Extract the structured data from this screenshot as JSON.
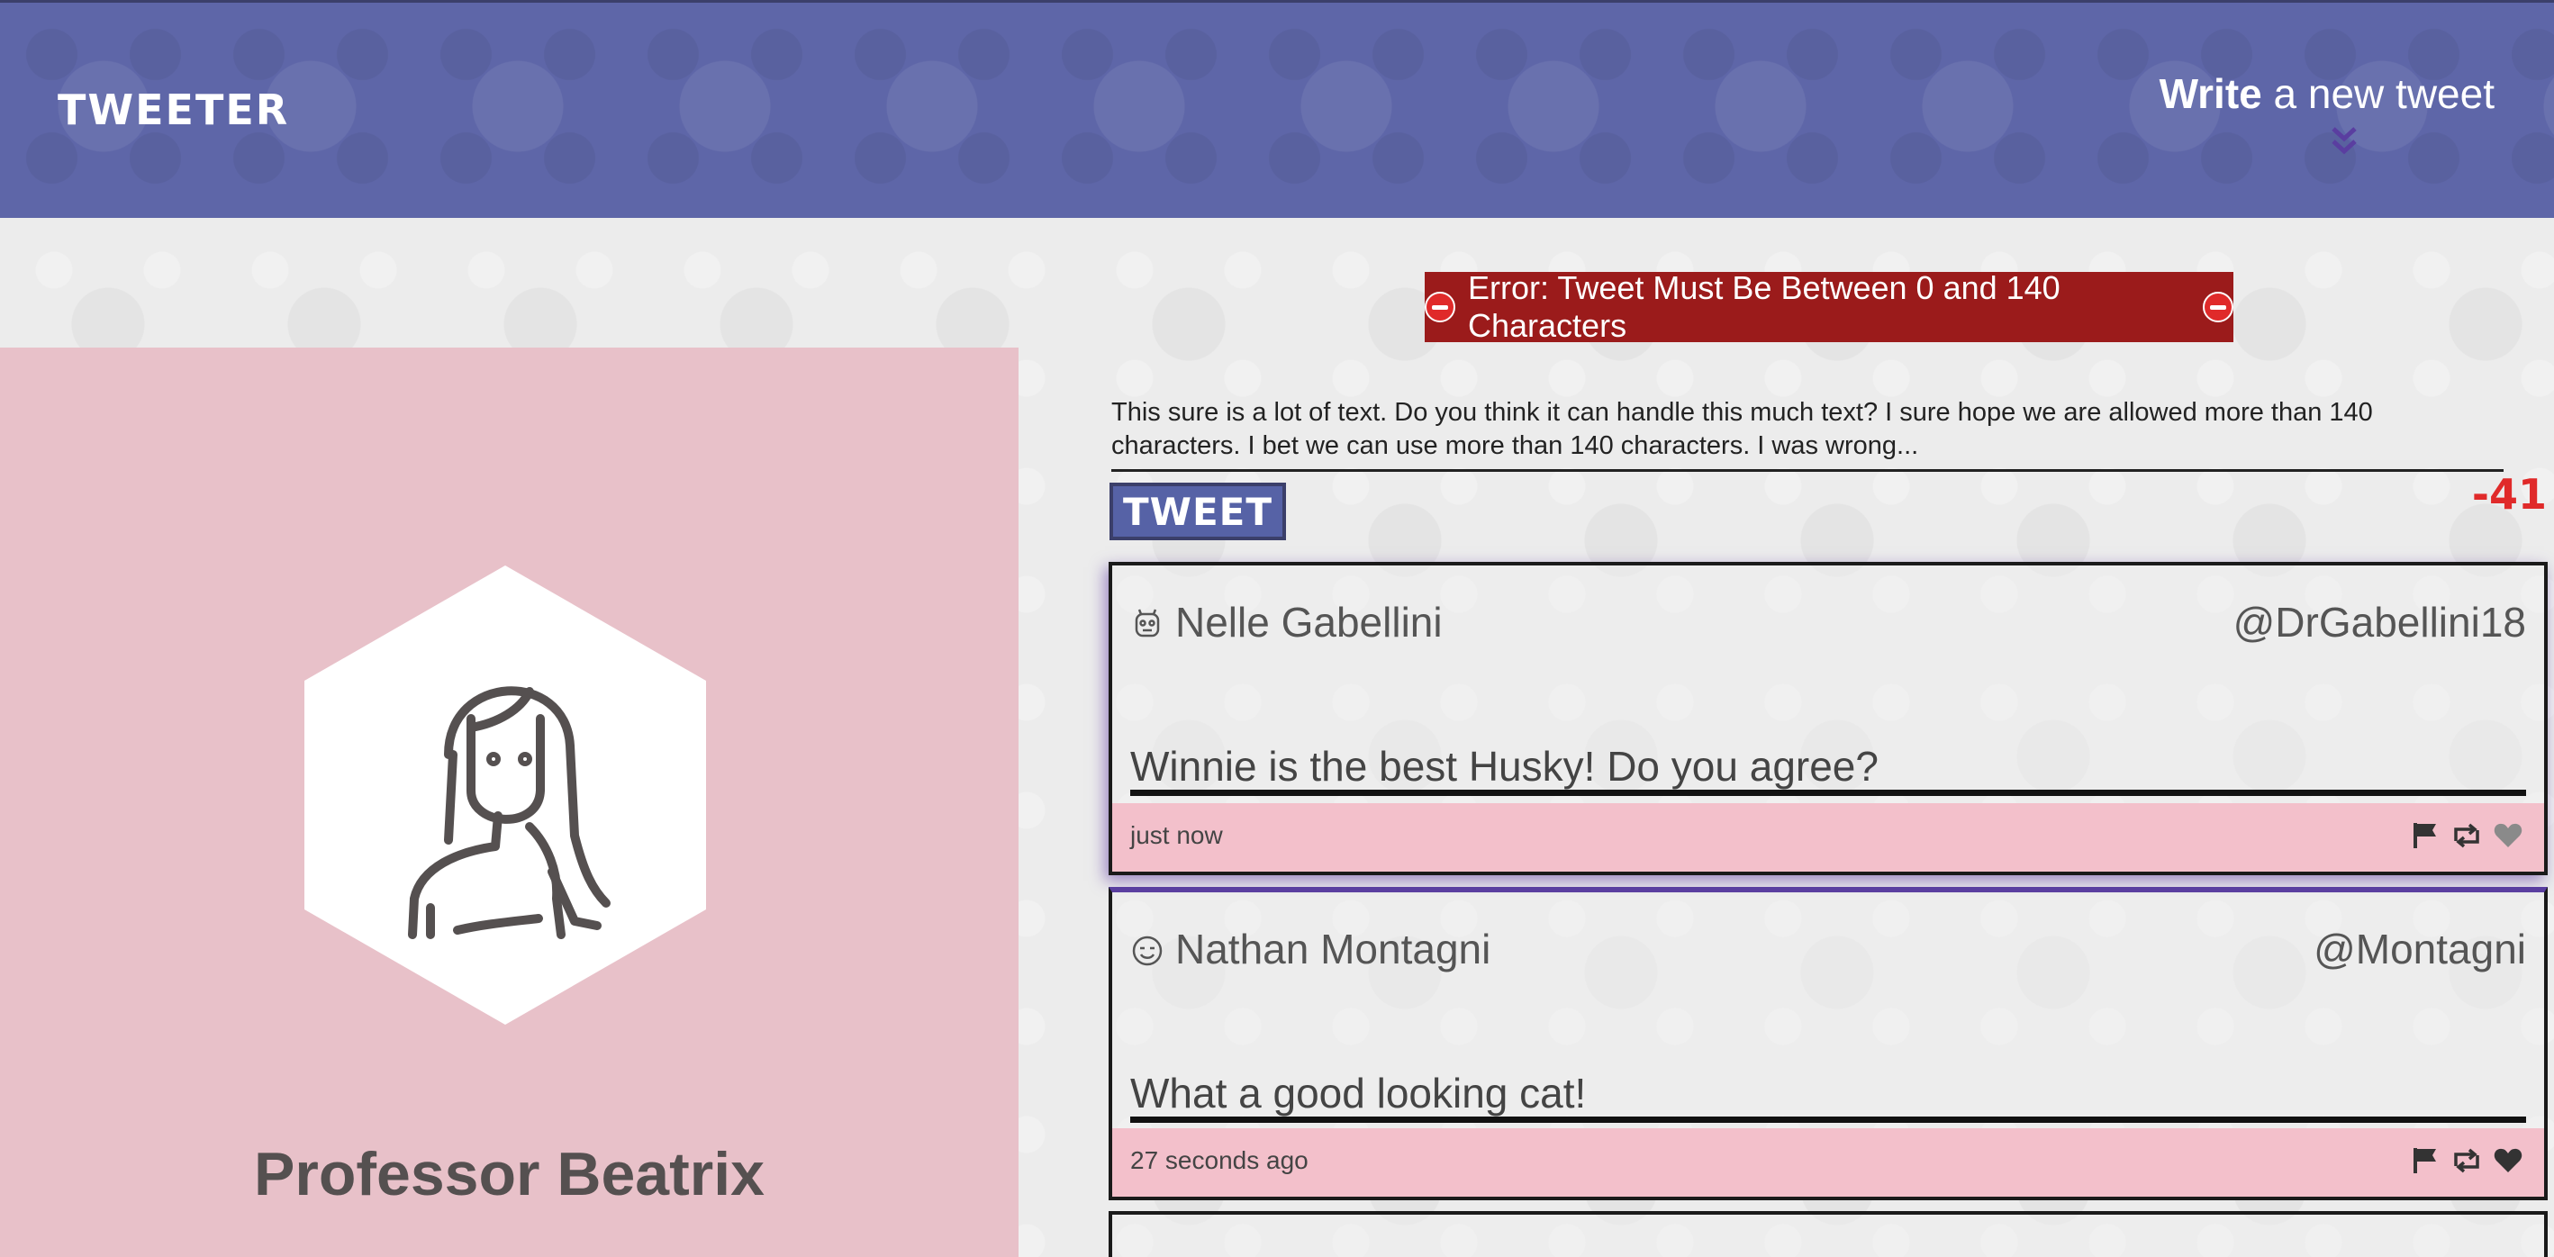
{
  "nav": {
    "brand": "TWEETER",
    "compose_bold": "Write",
    "compose_rest": " a new tweet",
    "chevron_icon": "double-chevron-down-icon"
  },
  "profile": {
    "name": "Professor Beatrix",
    "avatar_icon": "woman-avatar-icon"
  },
  "composer": {
    "error_text": "Error: Tweet Must Be Between 0 and 140 Characters",
    "error_icon": "no-entry-icon",
    "text": "This sure is a lot of text. Do you think it can handle this much text? I sure hope we are allowed more than 140 characters. I bet we can use more than 140 characters. I was wrong...",
    "button_label": "TWEET",
    "counter": "-41"
  },
  "tweets": [
    {
      "name": "Nelle Gabellini",
      "handle": "@DrGabellini18",
      "body": "Winnie is the best Husky! Do you agree?",
      "time": "just now",
      "avatar_icon": "robot-avatar-icon"
    },
    {
      "name": "Nathan Montagni",
      "handle": "@Montagni",
      "body": "What a good looking cat!",
      "time": "27 seconds ago",
      "avatar_icon": "smiley-avatar-icon"
    }
  ],
  "colors": {
    "nav_bg": "#5e66a8",
    "profile_bg": "#e8c1c9",
    "error_bg": "#9b1b1b",
    "counter": "#e02a2a",
    "footer_bg": "#f3c0cb"
  }
}
